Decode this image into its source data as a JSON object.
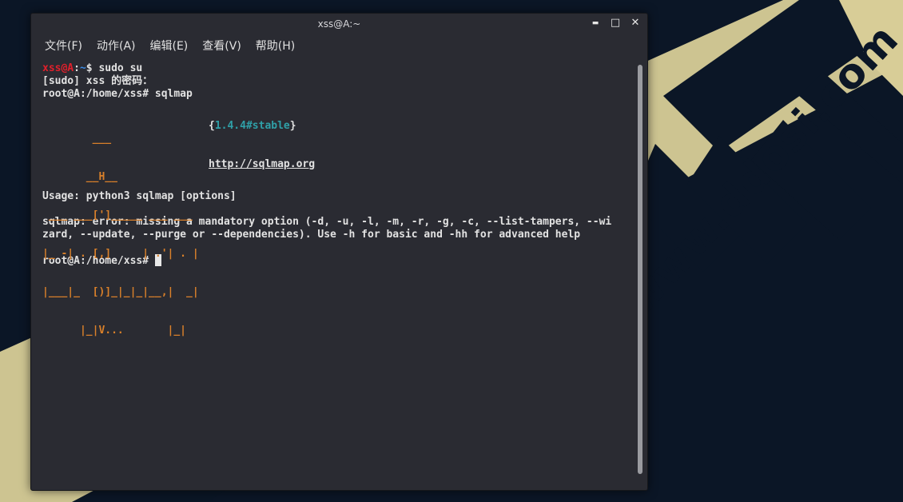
{
  "colors": {
    "desktop_bg": "#0b1626",
    "wallpaper_shape": "#d8cd97",
    "window_bg": "#2a2b32",
    "prompt_red": "#e0202b",
    "prompt_blue": "#3a8be6",
    "banner_orange": "#d9802a",
    "version_teal": "#2fa0a8"
  },
  "window": {
    "title": "xss@A:~",
    "controls": {
      "minimize": "▬",
      "maximize": "□",
      "close": "✕"
    }
  },
  "menubar": {
    "file": "文件(F)",
    "action": "动作(A)",
    "edit": "编辑(E)",
    "view": "查看(V)",
    "help": "帮助(H)"
  },
  "terminal": {
    "prompt1": {
      "user_host": "xss@A",
      "sep": ":",
      "path": "~",
      "symbol": "$",
      "command": " sudo su"
    },
    "sudo_prompt": "[sudo] xss 的密码：",
    "root_prompt1": "root@A:/home/xss# sqlmap",
    "banner": {
      "art": [
        "        ___",
        "       __H__",
        " ___ ___[']_____ ___ ___",
        "|_ -| . [,]     | .'| . |",
        "|___|_  [)]_|_|_|__,|  _|",
        "      |_|V...       |_|"
      ],
      "version_open": "{",
      "version": "1.4.4#stable",
      "version_close": "}",
      "url": "http://sqlmap.org"
    },
    "usage": "Usage: python3 sqlmap [options]",
    "error1": "sqlmap: error: missing a mandatory option (-d, -u, -l, -m, -r, -g, -c, --list-tampers, --wi",
    "error2": "zard, --update, --purge or --dependencies). Use -h for basic and -hh for advanced help",
    "root_prompt2": "root@A:/home/xss# "
  },
  "wallpaper": {
    "watermark": "www.ddosi.com"
  }
}
